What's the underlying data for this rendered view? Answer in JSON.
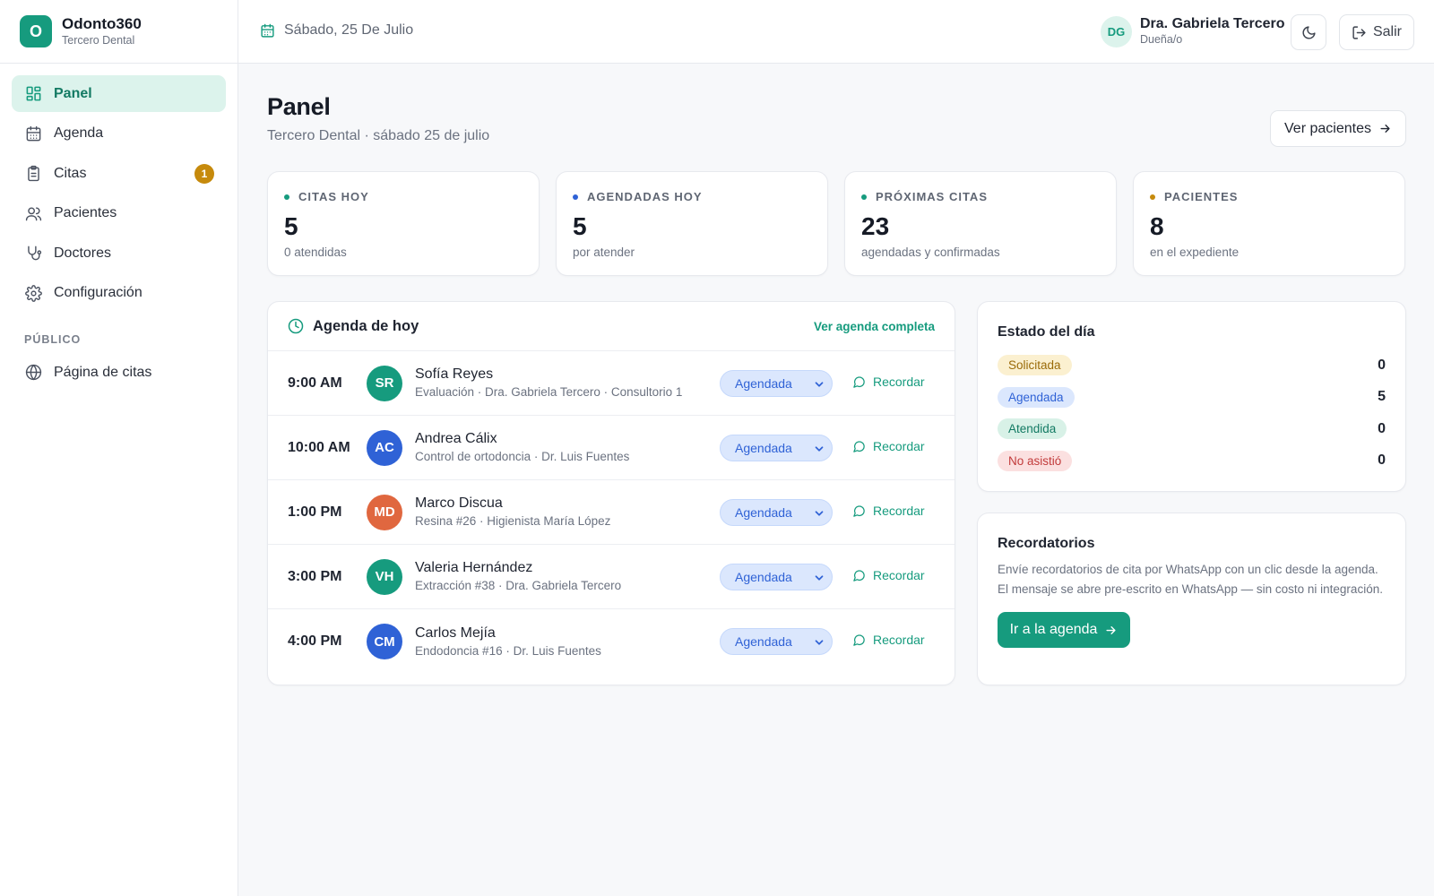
{
  "brand": {
    "logo_letter": "O",
    "name": "Odonto360",
    "subtitle": "Tercero Dental"
  },
  "sidebar": {
    "items": [
      {
        "label": "Panel",
        "icon": "dashboard-icon",
        "active": true
      },
      {
        "label": "Agenda",
        "icon": "calendar-icon"
      },
      {
        "label": "Citas",
        "icon": "clipboard-icon",
        "badge": "1"
      },
      {
        "label": "Pacientes",
        "icon": "users-icon"
      },
      {
        "label": "Doctores",
        "icon": "stethoscope-icon"
      },
      {
        "label": "Configuración",
        "icon": "gear-icon"
      }
    ],
    "section_label": "PÚBLICO",
    "public_items": [
      {
        "label": "Página de citas",
        "icon": "globe-icon"
      }
    ]
  },
  "topbar": {
    "date": "Sábado, 25 De Julio",
    "user": {
      "initials": "DG",
      "name": "Dra. Gabriela Tercero",
      "role": "Dueña/o"
    },
    "theme_icon": "moon-icon",
    "exit_label": "Salir"
  },
  "page": {
    "title": "Panel",
    "subtitle": "Tercero Dental · sábado 25 de julio",
    "action_label": "Ver pacientes"
  },
  "stats": [
    {
      "label": "CITAS HOY",
      "value": "5",
      "sub": "0 atendidas",
      "color": "#169b7e"
    },
    {
      "label": "AGENDADAS HOY",
      "value": "5",
      "sub": "por atender",
      "color": "#2f62d6"
    },
    {
      "label": "PRÓXIMAS CITAS",
      "value": "23",
      "sub": "agendadas y confirmadas",
      "color": "#169b7e"
    },
    {
      "label": "PACIENTES",
      "value": "8",
      "sub": "en el expediente",
      "color": "#c68a0c"
    }
  ],
  "agenda": {
    "title": "Agenda de hoy",
    "link": "Ver agenda completa",
    "remind_label": "Recordar",
    "rows": [
      {
        "time": "9:00 AM",
        "initials": "SR",
        "color": "#169b7e",
        "name": "Sofía Reyes",
        "detail": "Evaluación · Dra. Gabriela Tercero · Consultorio 1",
        "status": "Agendada"
      },
      {
        "time": "10:00 AM",
        "initials": "AC",
        "color": "#2f62d6",
        "name": "Andrea Cálix",
        "detail": "Control de ortodoncia · Dr. Luis Fuentes",
        "status": "Agendada"
      },
      {
        "time": "1:00 PM",
        "initials": "MD",
        "color": "#e0673f",
        "name": "Marco Discua",
        "detail": "Resina #26 · Higienista María López",
        "status": "Agendada"
      },
      {
        "time": "3:00 PM",
        "initials": "VH",
        "color": "#169b7e",
        "name": "Valeria Hernández",
        "detail": "Extracción #38 · Dra. Gabriela Tercero",
        "status": "Agendada"
      },
      {
        "time": "4:00 PM",
        "initials": "CM",
        "color": "#2f62d6",
        "name": "Carlos Mejía",
        "detail": "Endodoncia #16 · Dr. Luis Fuentes",
        "status": "Agendada"
      }
    ]
  },
  "estado": {
    "title": "Estado del día",
    "items": [
      {
        "label": "Solicitada",
        "count": "0",
        "bg": "#fbf0d0",
        "fg": "#9a6a08"
      },
      {
        "label": "Agendada",
        "count": "5",
        "bg": "#dbe7fd",
        "fg": "#2f62d6"
      },
      {
        "label": "Atendida",
        "count": "0",
        "bg": "#d8f1e7",
        "fg": "#137a63"
      },
      {
        "label": "No asistió",
        "count": "0",
        "bg": "#fbe0e0",
        "fg": "#c23b3b"
      }
    ]
  },
  "recordatorios": {
    "title": "Recordatorios",
    "text": "Envíe recordatorios de cita por WhatsApp con un clic desde la agenda. El mensaje se abre pre-escrito en WhatsApp — sin costo ni integración.",
    "button": "Ir a la agenda"
  }
}
